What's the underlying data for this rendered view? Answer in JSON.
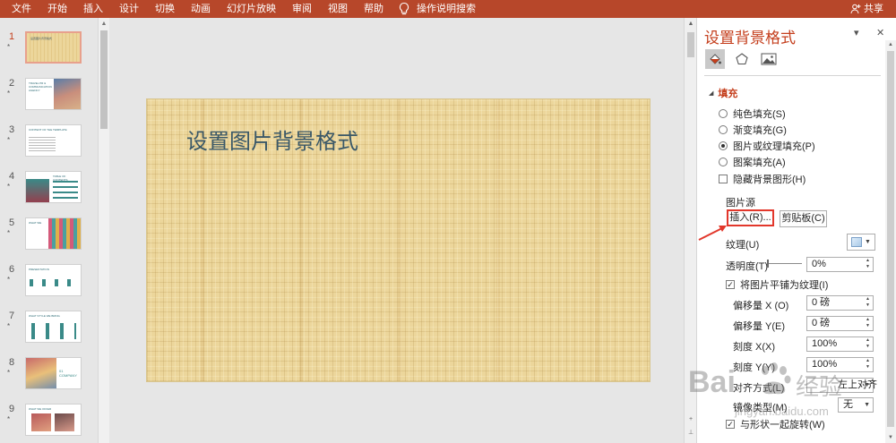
{
  "ribbon": {
    "tabs": [
      "文件",
      "开始",
      "插入",
      "设计",
      "切换",
      "动画",
      "幻灯片放映",
      "审阅",
      "视图",
      "帮助"
    ],
    "tell_me": "操作说明搜索",
    "share": "共享",
    "accent_color": "#b7472a"
  },
  "thumbnails": [
    {
      "num": "1",
      "star": "*",
      "active": true,
      "caption": "设置图片背景格式"
    },
    {
      "num": "2",
      "star": "*",
      "caption": "TRAVEL PR & COMMUNICATION AGENCY"
    },
    {
      "num": "3",
      "star": "*",
      "caption": "CONTENT OF THE TEMPLATE"
    },
    {
      "num": "4",
      "star": "*",
      "caption": "TABLE OF CONTENTS"
    },
    {
      "num": "5",
      "star": "*",
      "caption": "WHAT WE"
    },
    {
      "num": "6",
      "star": "*",
      "caption": "PRESENTATION"
    },
    {
      "num": "7",
      "star": "*",
      "caption": "WHAT STYLE WE BRING"
    },
    {
      "num": "8",
      "star": "*",
      "caption": "01 COMPANY"
    },
    {
      "num": "9",
      "star": "*",
      "caption": "WHAT WE OFFER"
    }
  ],
  "slide": {
    "title": "设置图片背景格式"
  },
  "pane": {
    "title": "设置背景格式",
    "dropdown_glyph": "▾",
    "close_glyph": "✕",
    "section_fill": "填充",
    "options": [
      {
        "label": "纯色填充(S)",
        "type": "radio",
        "checked": false
      },
      {
        "label": "渐变填充(G)",
        "type": "radio",
        "checked": false
      },
      {
        "label": "图片或纹理填充(P)",
        "type": "radio",
        "checked": true
      },
      {
        "label": "图案填充(A)",
        "type": "radio",
        "checked": false
      },
      {
        "label": "隐藏背景图形(H)",
        "type": "checkbox",
        "checked": false
      }
    ],
    "picture_source": "图片源",
    "insert_button": "插入(R)...",
    "clipboard_button": "剪贴板(C)",
    "texture_label": "纹理(U)",
    "transparency_label": "透明度(T)",
    "transparency_value": "0%",
    "transparency_level": 0,
    "tile_label": "将图片平铺为纹理(I)",
    "tile_checked": true,
    "offset_x_label": "偏移量 X (O)",
    "offset_x_value": "0 磅",
    "offset_y_label": "偏移量 Y(E)",
    "offset_y_value": "0 磅",
    "scale_x_label": "刻度 X(X)",
    "scale_x_value": "100%",
    "scale_y_label": "刻度 Y(Y)",
    "scale_y_value": "100%",
    "alignment_label": "对齐方式(L)",
    "alignment_value": "左上对齐",
    "mirror_label": "镜像类型(M)",
    "mirror_value": "无",
    "rotate_label": "与形状一起旋转(W)"
  },
  "watermark": {
    "brand": "Bai",
    "brand_cn": "经验",
    "url": "jingyan.baidu.com"
  }
}
